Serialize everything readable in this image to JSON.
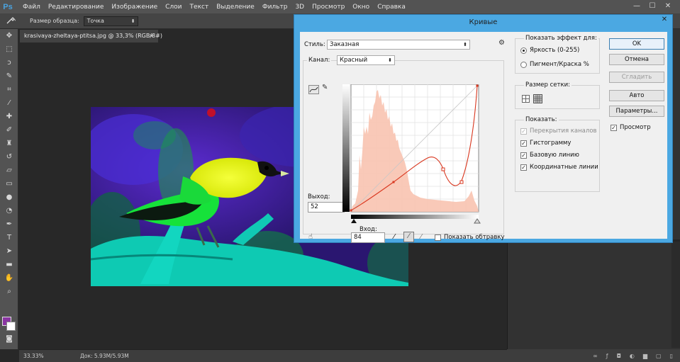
{
  "app": {
    "logo": "Ps",
    "menu": [
      "Файл",
      "Редактирование",
      "Изображение",
      "Слои",
      "Текст",
      "Выделение",
      "Фильтр",
      "3D",
      "Просмотр",
      "Окно",
      "Справка"
    ],
    "window_controls": [
      "—",
      "☐",
      "✕"
    ]
  },
  "options_bar": {
    "sample_size_label": "Размер образца:",
    "sample_size_value": "Точка"
  },
  "document": {
    "tab_title": "krasivaya-zheltaya-ptitsa.jpg @ 33,3% (RGB/8#)",
    "tab_close": "×",
    "zoom": "33.33%",
    "doc_size": "Док: 5.93M/5.93M"
  },
  "dialog": {
    "title": "Кривые",
    "close": "✕",
    "style_label": "Стиль:",
    "style_value": "Заказная",
    "channel_label": "Канал:",
    "channel_value": "Красный",
    "output_label": "Выход:",
    "output_value": "52",
    "input_label": "Вход:",
    "input_value": "84",
    "show_clipping": "Показать обтравку",
    "show_effect_title": "Показать эффект для:",
    "radio_brightness": "Яркость (0-255)",
    "radio_pigment": "Пигмент/Краска %",
    "grid_size_title": "Размер сетки:",
    "show_title": "Показать:",
    "show_overlays": "Перекрытия каналов",
    "show_histogram": "Гистограмму",
    "show_baseline": "Базовую линию",
    "show_intersection": "Координатные линии",
    "btn_ok": "OK",
    "btn_cancel": "Отмена",
    "btn_smooth": "Сгладить",
    "btn_auto": "Авто",
    "btn_options": "Параметры...",
    "preview_label": "Просмотр",
    "checked_mark": "✓",
    "curve_color": "#d9371f",
    "histogram_color": "#f8c3b0"
  }
}
